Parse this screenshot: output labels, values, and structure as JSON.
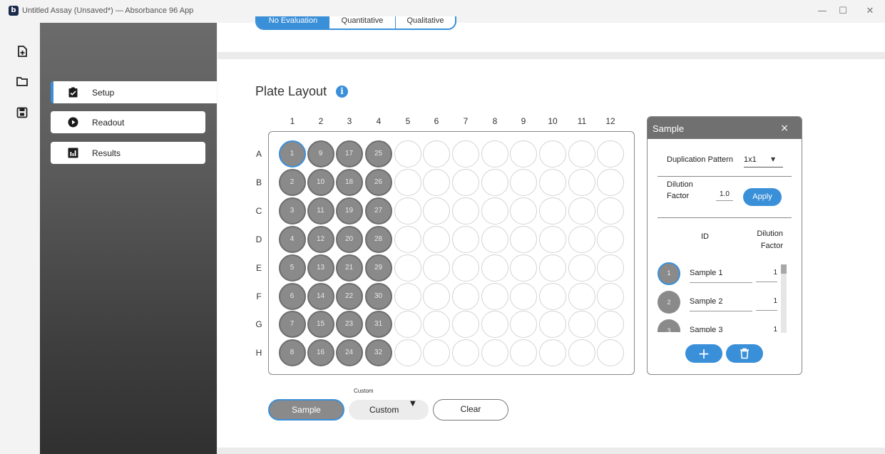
{
  "window": {
    "title": "Untitled Assay (Unsaved*) — Absorbance 96 App",
    "logo_letter": "b",
    "controls": {
      "minimize": "—",
      "maximize": "☐",
      "close": "✕"
    }
  },
  "rail": {
    "icons": [
      "new-file-icon",
      "folder-icon",
      "save-icon"
    ]
  },
  "sidebar": {
    "items": [
      {
        "label": "Setup",
        "icon": "clipboard-check-icon",
        "active": true
      },
      {
        "label": "Readout",
        "icon": "play-circle-icon",
        "active": false
      },
      {
        "label": "Results",
        "icon": "bar-chart-icon",
        "active": false
      }
    ]
  },
  "evaluation_tabs": [
    "No Evaluation",
    "Quantitative",
    "Qualitative"
  ],
  "plate": {
    "title": "Plate Layout",
    "info_glyph": "i",
    "columns": [
      "1",
      "2",
      "3",
      "4",
      "5",
      "6",
      "7",
      "8",
      "9",
      "10",
      "11",
      "12"
    ],
    "rows": [
      "A",
      "B",
      "C",
      "D",
      "E",
      "F",
      "G",
      "H"
    ],
    "filled_columns": 4,
    "selected_well": "A1"
  },
  "panel": {
    "title": "Sample",
    "close_glyph": "×",
    "duplication_label": "Duplication Pattern",
    "duplication_value": "1x1",
    "dilution_label": "Dilution Factor",
    "dilution_value": "1.0",
    "apply_label": "Apply",
    "id_header": "ID",
    "dilution_header": "Dilution Factor",
    "samples": [
      {
        "num": "1",
        "name": "Sample 1",
        "factor": "1"
      },
      {
        "num": "2",
        "name": "Sample 2",
        "factor": "1"
      },
      {
        "num": "3",
        "name": "Sample 3",
        "factor": "1"
      }
    ],
    "add_glyph": "+",
    "delete_icon": "trash-icon"
  },
  "bottom": {
    "custom_caption": "Custom",
    "sample_label": "Sample",
    "custom_label": "Custom",
    "clear_label": "Clear"
  },
  "colors": {
    "accent": "#3a8fd9",
    "filled_well": "#8a8a8a",
    "panel_header": "#707070"
  }
}
